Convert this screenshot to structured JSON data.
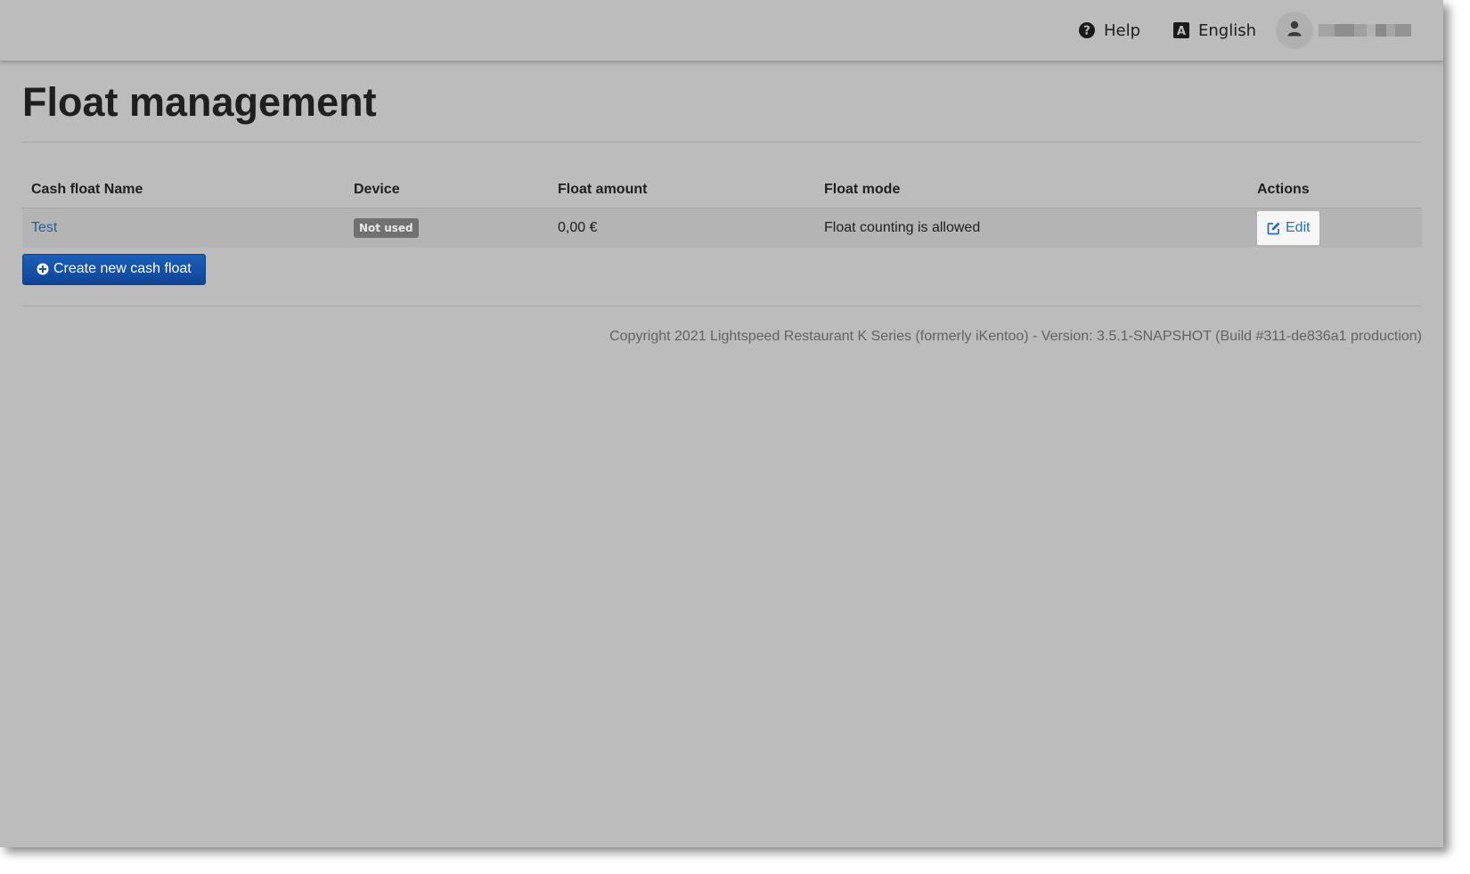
{
  "topbar": {
    "help_label": "Help",
    "language_label": "English",
    "icons": {
      "help": "question-circle-icon",
      "language": "language-a-icon",
      "user": "user-icon"
    }
  },
  "page": {
    "title": "Float management"
  },
  "table": {
    "headers": [
      "Cash float Name",
      "Device",
      "Float amount",
      "Float mode",
      "Actions"
    ],
    "rows": [
      {
        "name": "Test",
        "device": "Not used",
        "amount": "0,00 €",
        "mode": "Float counting is allowed",
        "action": "Edit"
      }
    ]
  },
  "actions": {
    "create_label": "Create new cash float"
  },
  "footer": {
    "copyright": "Copyright 2021 Lightspeed Restaurant K Series (formerly iKentoo) - Version: 3.5.1-SNAPSHOT (Build #311-de836a1 production)"
  },
  "colors": {
    "background": "#bcbcbc",
    "primary_button": "#1456a8",
    "link": "#1e5f9e",
    "badge": "#717171"
  }
}
